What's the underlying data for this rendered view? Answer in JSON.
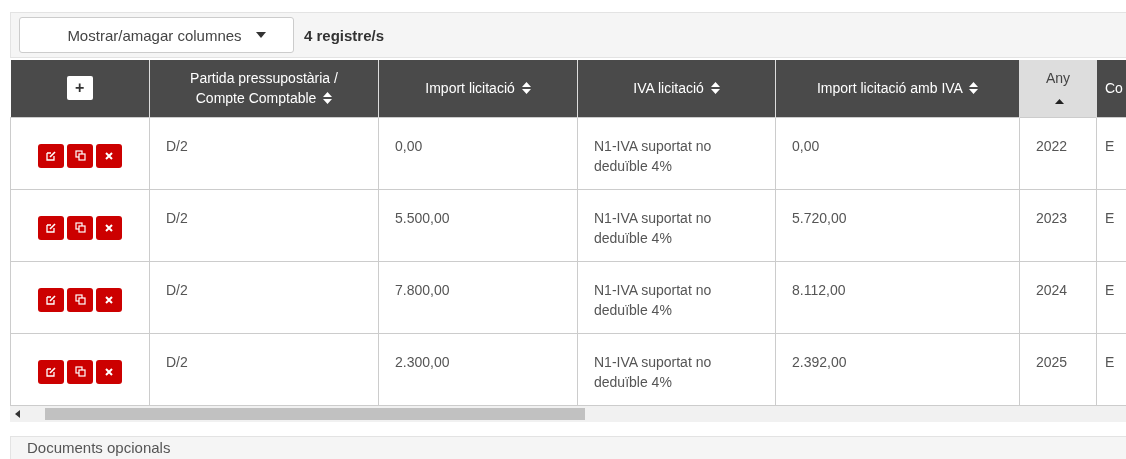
{
  "toolbar": {
    "columns_dropdown": "Mostrar/amagar columnes",
    "record_count": "4 registre/s"
  },
  "table": {
    "add_button": "+",
    "columns": [
      {
        "label": "Partida pressupostària / Compte Comptable",
        "sortable": true,
        "sorted": false
      },
      {
        "label": "Import licitació",
        "sortable": true,
        "sorted": false
      },
      {
        "label": "IVA licitació",
        "sortable": true,
        "sorted": false
      },
      {
        "label": "Import licitació amb IVA",
        "sortable": true,
        "sorted": false
      },
      {
        "label": "Any",
        "sortable": true,
        "sorted": true
      },
      {
        "label": "Co",
        "sortable": false,
        "sorted": false
      }
    ],
    "rows": [
      {
        "cells": [
          "D/2",
          "0,00",
          "N1-IVA suportat no deduïble 4%",
          "0,00",
          "2022",
          "E"
        ]
      },
      {
        "cells": [
          "D/2",
          "5.500,00",
          "N1-IVA suportat no deduïble 4%",
          "5.720,00",
          "2023",
          "E"
        ]
      },
      {
        "cells": [
          "D/2",
          "7.800,00",
          "N1-IVA suportat no deduïble 4%",
          "8.112,00",
          "2024",
          "E"
        ]
      },
      {
        "cells": [
          "D/2",
          "2.300,00",
          "N1-IVA suportat no deduïble 4%",
          "2.392,00",
          "2025",
          "E"
        ]
      }
    ]
  },
  "section": {
    "title": "Documents opcionals"
  }
}
